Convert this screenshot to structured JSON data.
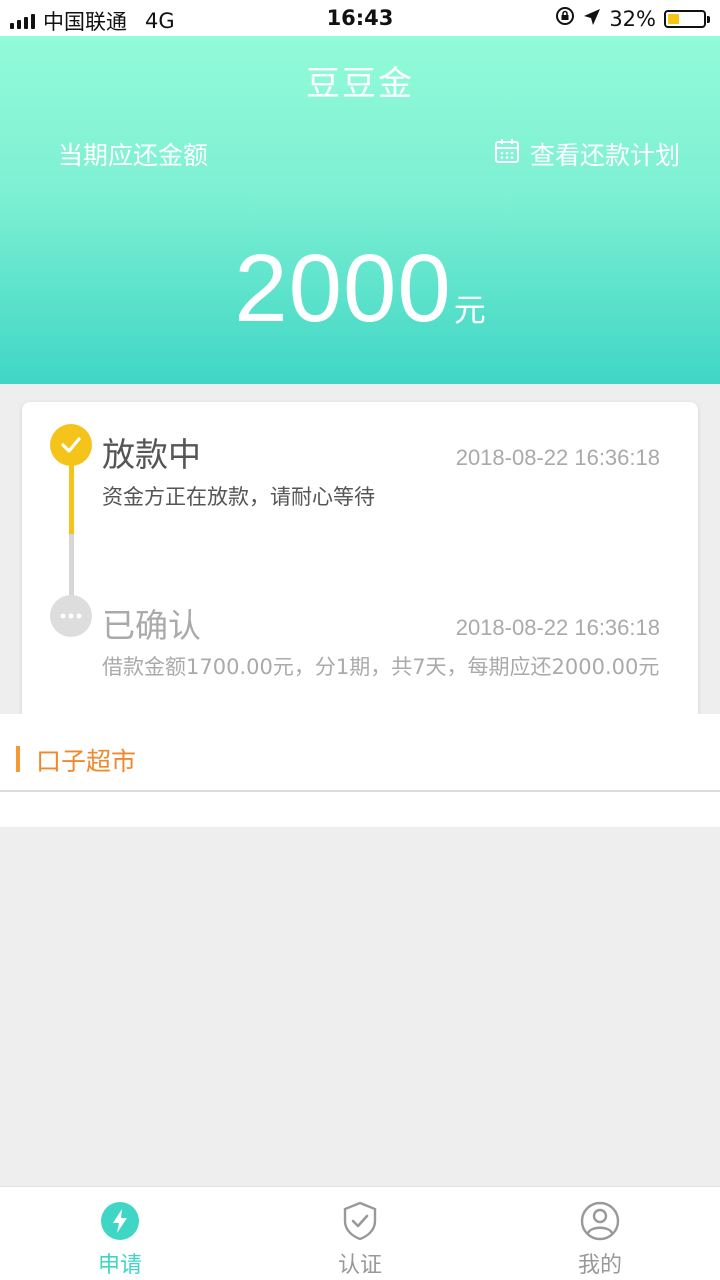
{
  "status_bar": {
    "carrier": "中国联通",
    "network": "4G",
    "time": "16:43",
    "battery_percent": "32%",
    "battery_level": 0.32
  },
  "header": {
    "title": "豆豆金",
    "due_label": "当期应还金额",
    "plan_link": "查看还款计划",
    "amount": "2000",
    "unit": "元"
  },
  "timeline": {
    "steps": [
      {
        "title": "放款中",
        "time": "2018-08-22 16:36:18",
        "desc": "资金方正在放款，请耐心等待",
        "state": "active"
      },
      {
        "title": "已确认",
        "time": "2018-08-22 16:36:18",
        "desc": "借款金额1700.00元，分1期，共7天，每期应还2000.00元",
        "state": "done"
      }
    ]
  },
  "market": {
    "title": "口子超市"
  },
  "tabs": [
    {
      "label": "申请",
      "icon": "lightning-icon",
      "active": true
    },
    {
      "label": "认证",
      "icon": "shield-check-icon",
      "active": false
    },
    {
      "label": "我的",
      "icon": "user-icon",
      "active": false
    }
  ],
  "colors": {
    "accent": "#3fd6c5",
    "active_step": "#f4c41b",
    "market": "#f0892b",
    "inactive": "#aaaaaa"
  }
}
